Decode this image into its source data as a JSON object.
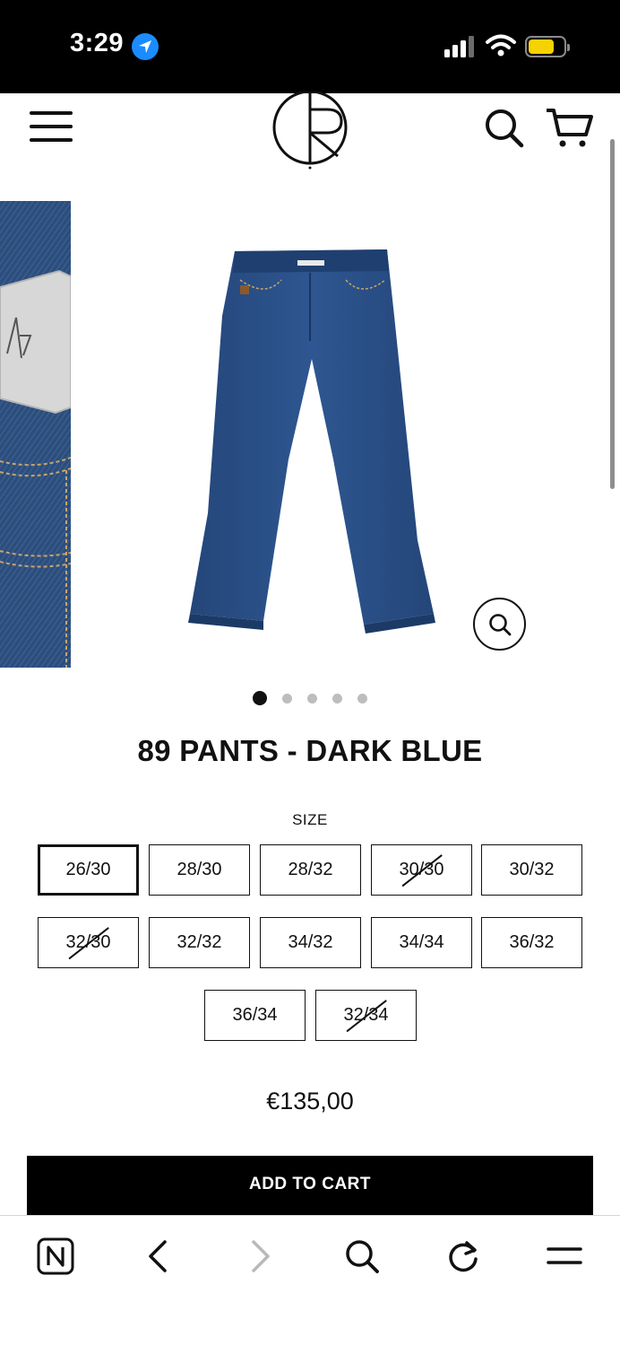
{
  "status_bar": {
    "time": "3:29",
    "icons": [
      "location-arrow-icon",
      "cellular-signal-icon",
      "wifi-icon",
      "battery-icon"
    ],
    "battery_color": "#f5d200"
  },
  "header": {
    "icons": [
      "hamburger-menu-icon",
      "polar-logo",
      "search-icon",
      "cart-icon"
    ]
  },
  "gallery": {
    "slide_count": 5,
    "active_index": 0,
    "product_color": "#2b4f86"
  },
  "product": {
    "title": "89 PANTS - DARK BLUE",
    "size_label": "SIZE",
    "sizes": [
      {
        "label": "26/30",
        "selected": true,
        "available": true
      },
      {
        "label": "28/30",
        "selected": false,
        "available": true
      },
      {
        "label": "28/32",
        "selected": false,
        "available": true
      },
      {
        "label": "30/30",
        "selected": false,
        "available": false
      },
      {
        "label": "30/32",
        "selected": false,
        "available": true
      },
      {
        "label": "32/30",
        "selected": false,
        "available": false
      },
      {
        "label": "32/32",
        "selected": false,
        "available": true
      },
      {
        "label": "34/32",
        "selected": false,
        "available": true
      },
      {
        "label": "34/34",
        "selected": false,
        "available": true
      },
      {
        "label": "36/32",
        "selected": false,
        "available": true
      },
      {
        "label": "36/34",
        "selected": false,
        "available": true
      },
      {
        "label": "32/34",
        "selected": false,
        "available": false
      }
    ],
    "price": "€135,00",
    "add_to_cart": "ADD TO CART"
  },
  "browser_bar": {
    "icons": [
      "n-tab-icon",
      "back-icon",
      "forward-icon",
      "search-icon",
      "reload-icon",
      "menu-icon"
    ]
  }
}
